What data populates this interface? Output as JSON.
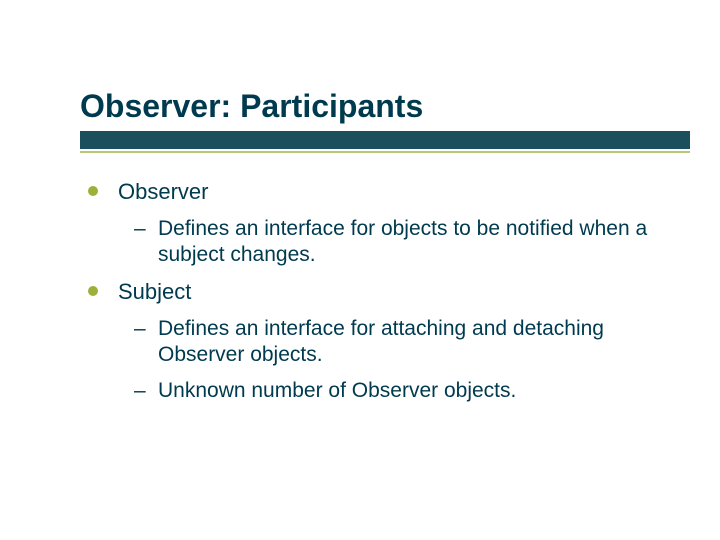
{
  "slide": {
    "title": "Observer: Participants",
    "items": [
      {
        "label": "Observer",
        "subs": [
          {
            "text": "Defines an interface for objects to be notified when a subject changes."
          }
        ]
      },
      {
        "label": "Subject",
        "subs": [
          {
            "text": "Defines an interface for attaching and detaching Observer objects."
          },
          {
            "text": "Unknown number of Observer objects."
          }
        ]
      }
    ]
  }
}
